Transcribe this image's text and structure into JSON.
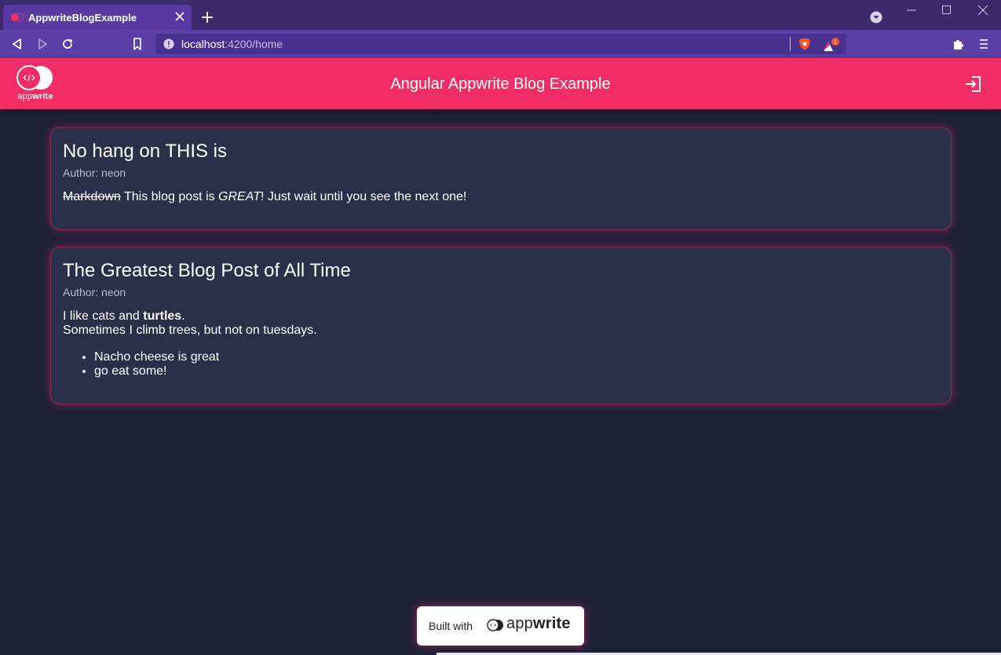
{
  "browser": {
    "tab_title": "AppwriteBlogExample",
    "url_host": "localhost",
    "url_path": ":4200/home",
    "rewards_count": "1"
  },
  "header": {
    "logo_text_light": "app",
    "logo_text_bold": "write",
    "title": "Angular Appwrite Blog Example"
  },
  "posts": [
    {
      "title": "No hang on THIS is",
      "author": "Author: neon",
      "strike": "Markdown",
      "text_before_italic": " This blog post is ",
      "italic": "GREAT",
      "text_after_italic": "! Just wait until you see the next one!"
    },
    {
      "title": "The Greatest Blog Post of All Time",
      "author": "Author: neon",
      "line1_prefix": "I like cats and ",
      "line1_bold": "turtles",
      "line1_suffix": ".",
      "line2": "Sometimes I climb trees, but not on tuesdays.",
      "list": [
        "Nacho cheese is great",
        "go eat some!"
      ]
    }
  ],
  "footer": {
    "built_with": "Built with",
    "brand_light": "app",
    "brand_bold": "write"
  },
  "colors": {
    "accent": "#f02e65",
    "background": "#1f2139",
    "card": "#2a2f4a",
    "browser_frame": "#3d2a6c"
  }
}
